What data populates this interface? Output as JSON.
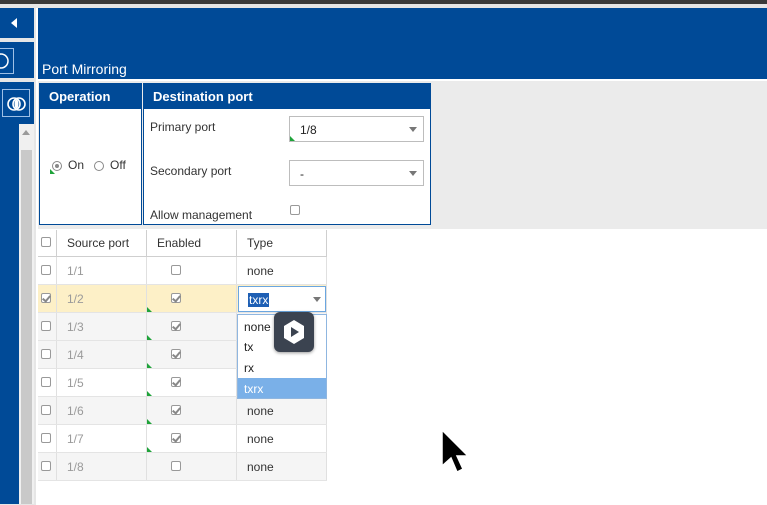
{
  "header": {
    "title": "Port Mirroring"
  },
  "operation": {
    "title": "Operation",
    "on_label": "On",
    "off_label": "Off",
    "selected": "On"
  },
  "destination": {
    "title": "Destination port",
    "primary_label": "Primary port",
    "primary_value": "1/8",
    "secondary_label": "Secondary port",
    "secondary_value": "-",
    "allow_label": "Allow management",
    "allow_checked": false
  },
  "table": {
    "headers": {
      "source": "Source port",
      "enabled": "Enabled",
      "type": "Type"
    },
    "rows": [
      {
        "port": "1/1",
        "selected": false,
        "enabled": false,
        "type": "none"
      },
      {
        "port": "1/2",
        "selected": true,
        "enabled": true,
        "type": "txrx"
      },
      {
        "port": "1/3",
        "selected": false,
        "enabled": true,
        "type": ""
      },
      {
        "port": "1/4",
        "selected": false,
        "enabled": true,
        "type": ""
      },
      {
        "port": "1/5",
        "selected": false,
        "enabled": true,
        "type": ""
      },
      {
        "port": "1/6",
        "selected": false,
        "enabled": true,
        "type": "none"
      },
      {
        "port": "1/7",
        "selected": false,
        "enabled": true,
        "type": "none"
      },
      {
        "port": "1/8",
        "selected": false,
        "enabled": false,
        "type": "none"
      }
    ]
  },
  "type_dropdown": {
    "options": [
      "none",
      "tx",
      "rx",
      "txrx"
    ],
    "selected": "txrx"
  },
  "colors": {
    "brand": "#004a97",
    "highlight_row": "#fdf0c7",
    "dropdown_selected": "#7ab0e8"
  },
  "icons": [
    "collapse-left-icon",
    "rings-icon",
    "overlay-badge-icon",
    "mouse-pointer-icon"
  ]
}
